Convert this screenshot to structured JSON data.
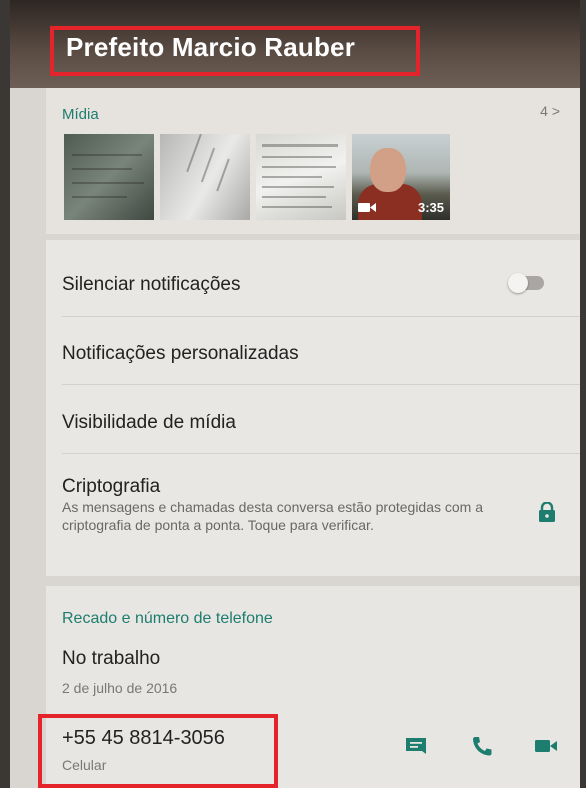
{
  "contact": {
    "name": "Prefeito Marcio Rauber"
  },
  "media": {
    "label": "Mídia",
    "count": "4 >",
    "video_duration": "3:35"
  },
  "settings": {
    "mute_label": "Silenciar notificações",
    "mute_enabled": false,
    "custom_notifications_label": "Notificações personalizadas",
    "media_visibility_label": "Visibilidade de mídia",
    "encryption_title": "Criptografia",
    "encryption_desc": "As mensagens e chamadas desta conversa estão protegidas com a criptografia de ponta a ponta. Toque para verificar."
  },
  "about": {
    "section_label": "Recado e número de telefone",
    "status": "No trabalho",
    "status_date": "2 de julho de 2016",
    "phone_number": "+55 45 8814-3056",
    "phone_type": "Celular"
  },
  "icons": {
    "message": "message-icon",
    "call": "phone-icon",
    "video": "video-call-icon",
    "lock": "lock-icon"
  },
  "colors": {
    "accent": "#1d7d6e",
    "highlight_box": "#e5232b"
  }
}
